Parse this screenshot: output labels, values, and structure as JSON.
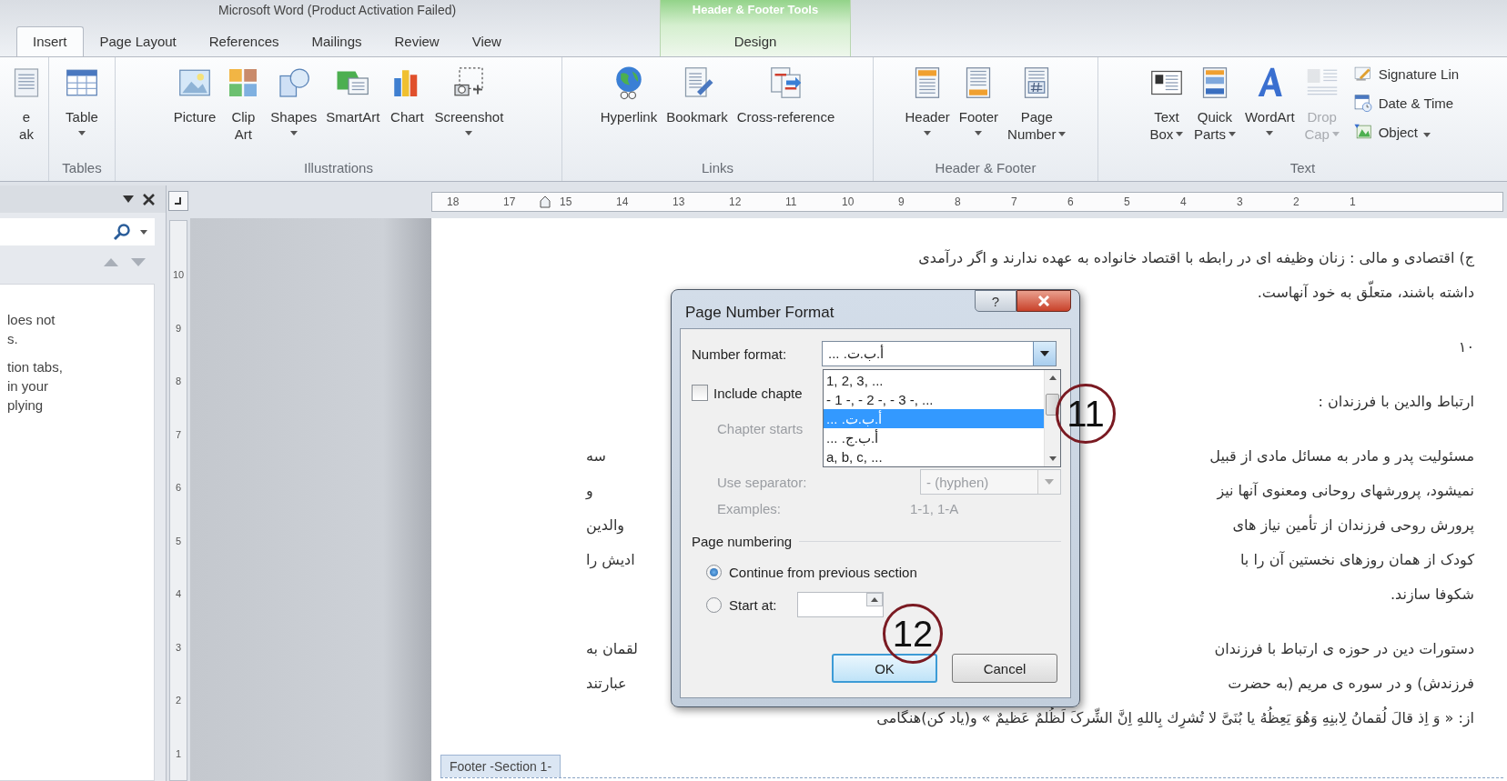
{
  "window": {
    "title": "Microsoft Word (Product Activation Failed)"
  },
  "tabs": [
    {
      "label": "Insert",
      "selected": true
    },
    {
      "label": "Page Layout",
      "selected": false
    },
    {
      "label": "References",
      "selected": false
    },
    {
      "label": "Mailings",
      "selected": false
    },
    {
      "label": "Review",
      "selected": false
    },
    {
      "label": "View",
      "selected": false
    }
  ],
  "contextual_tabs": {
    "label": "Header & Footer Tools",
    "tabs": [
      {
        "label": "Design",
        "selected": false
      }
    ]
  },
  "ribbon": {
    "groups": [
      {
        "buttons": [
          {
            "lines": [
              "e",
              "ak"
            ],
            "dropdown": false,
            "disabled": false
          }
        ]
      },
      {
        "label": "Tables",
        "buttons": [
          {
            "lines": [
              "Table"
            ],
            "dropdown": true,
            "disabled": false
          }
        ]
      },
      {
        "label": "Illustrations",
        "buttons": [
          {
            "lines": [
              "Picture"
            ],
            "dropdown": false,
            "disabled": false
          },
          {
            "lines": [
              "Clip",
              "Art"
            ],
            "dropdown": false,
            "disabled": false
          },
          {
            "lines": [
              "Shapes"
            ],
            "dropdown": true,
            "disabled": false
          },
          {
            "lines": [
              "SmartArt"
            ],
            "dropdown": false,
            "disabled": false
          },
          {
            "lines": [
              "Chart"
            ],
            "dropdown": false,
            "disabled": false
          },
          {
            "lines": [
              "Screenshot"
            ],
            "dropdown": true,
            "disabled": false
          }
        ]
      },
      {
        "label": "Links",
        "buttons": [
          {
            "lines": [
              "Hyperlink"
            ],
            "dropdown": false,
            "disabled": false
          },
          {
            "lines": [
              "Bookmark"
            ],
            "dropdown": false,
            "disabled": false
          },
          {
            "lines": [
              "Cross-reference"
            ],
            "dropdown": false,
            "disabled": false
          }
        ]
      },
      {
        "label": "Header & Footer",
        "buttons": [
          {
            "lines": [
              "Header"
            ],
            "dropdown": true,
            "disabled": false
          },
          {
            "lines": [
              "Footer"
            ],
            "dropdown": true,
            "disabled": false
          },
          {
            "lines": [
              "Page",
              "Number"
            ],
            "dropdown": true,
            "disabled": false
          }
        ]
      },
      {
        "label": "Text",
        "buttons": [
          {
            "lines": [
              "Text",
              "Box"
            ],
            "dropdown": true,
            "disabled": false
          },
          {
            "lines": [
              "Quick",
              "Parts"
            ],
            "dropdown": true,
            "disabled": false
          },
          {
            "lines": [
              "WordArt"
            ],
            "dropdown": true,
            "disabled": false
          },
          {
            "lines": [
              "Drop",
              "Cap"
            ],
            "dropdown": true,
            "disabled": true
          }
        ],
        "small_buttons": [
          {
            "label": "Signature Lin",
            "dropdown": false
          },
          {
            "label": "Date & Time",
            "dropdown": false
          },
          {
            "label": "Object",
            "dropdown": true
          }
        ]
      }
    ]
  },
  "navigation_pane": {
    "result_texts": [
      [
        "loes not",
        "s."
      ],
      [
        "tion tabs,",
        "in your",
        "plying"
      ]
    ]
  },
  "rulers": {
    "horizontal": [
      "18",
      "17",
      "15",
      "14",
      "13",
      "12",
      "11",
      "10",
      "9",
      "8",
      "7",
      "6",
      "5",
      "4",
      "3",
      "2",
      "1"
    ],
    "vertical": [
      "10",
      "9",
      "8",
      "7",
      "6",
      "5",
      "4",
      "3",
      "2",
      "1"
    ]
  },
  "document": {
    "paragraphs": [
      {
        "lines": [
          {
            "text": "ج) اقتصادی و مالی : زنان وظیفه ای در رابطه با اقتصاد خانواده به عهده ندارند و اگر درآمدی"
          },
          {
            "text": "داشته باشند، متعلّق به خود آنهاست."
          }
        ]
      },
      {
        "lines": [
          {
            "text": "۱۰"
          }
        ]
      },
      {
        "lines": [
          {
            "text": "ارتباط والدین با فرزندان :"
          }
        ]
      },
      {
        "lines": [
          {
            "text": "مسئولیت پدر و مادر به مسائل مادی از قبیل",
            "end": "سه"
          },
          {
            "text": "نمیشود، پرورشهای روحانی ومعنوی آنها نیز",
            "end": "و"
          },
          {
            "text": "پرورش روحی فرزندان از تأمین نیاز های",
            "end": "والدین"
          },
          {
            "text": "کودک از همان روزهای نخستین آن را با",
            "end": "ادیش را"
          },
          {
            "text": "شکوفا سازند."
          }
        ]
      },
      {
        "lines": [
          {
            "text": "دستورات دین در حوزه ی ارتباط با فرزندان",
            "end": "لقمان به"
          },
          {
            "text": "فرزندش) و در سوره ی مریم (به حضرت",
            "end": "عبارتند"
          },
          {
            "text": "از: « وَ اِذ قالَ لُقمانُ لِابنِهِ وَهُوَ یَعِظُهُ یا بُنَیَّ لا تُشرِك بِاللهِ اِنَّ الشِّرکَ لَظُلمٌ عَظیمٌ » و(یاد کن)هنگامی"
          }
        ]
      }
    ]
  },
  "footer_tag": "Footer -Section 1-",
  "dialog": {
    "title": "Page Number Format",
    "help_button": "?",
    "number_format": {
      "label": "Number format:",
      "value": "أ.ب.ت. ...",
      "options": [
        {
          "label": "1, 2, 3, ...",
          "selected": false
        },
        {
          "label": "- 1 -, - 2 -, - 3 -, ...",
          "selected": false
        },
        {
          "label": "أ.ب.ت. ...",
          "selected": true
        },
        {
          "label": "أ.ب.ج. ...",
          "selected": false
        },
        {
          "label": "a, b, c, ...",
          "selected": false
        }
      ]
    },
    "include_chapter": {
      "label": "Include chapte",
      "checked": false
    },
    "chapter_options": {
      "disabled": true,
      "chapter_starts_label": "Chapter starts",
      "separator_label": "Use separator:",
      "separator_value": "- (hyphen)",
      "examples_label": "Examples:",
      "examples_value": "1-1, 1-A"
    },
    "page_numbering": {
      "label": "Page numbering",
      "options": [
        {
          "label": "Continue from previous section",
          "selected": true
        },
        {
          "label": "Start at:",
          "selected": false
        }
      ]
    },
    "buttons": [
      "OK",
      "Cancel"
    ]
  },
  "callouts": [
    "11",
    "12"
  ]
}
